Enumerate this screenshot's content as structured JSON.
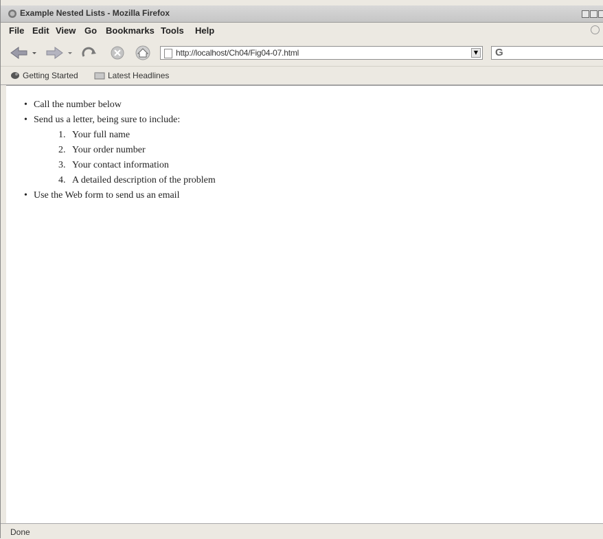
{
  "window": {
    "title": "Example Nested Lists - Mozilla Firefox"
  },
  "menu": {
    "items": [
      {
        "label": "File"
      },
      {
        "label": "Edit"
      },
      {
        "label": "View"
      },
      {
        "label": "Go"
      },
      {
        "label": "Bookmarks"
      },
      {
        "label": "Tools"
      },
      {
        "label": "Help"
      }
    ]
  },
  "navigation": {
    "url": "http://localhost/Ch04/Fig04-07.html",
    "icons": [
      "back-icon",
      "forward-icon",
      "reload-icon",
      "stop-icon",
      "home-icon"
    ]
  },
  "bookmarks": {
    "items": [
      {
        "label": "Getting Started",
        "icon": "getting-started-icon"
      },
      {
        "label": "Latest Headlines",
        "icon": "rss-folder-icon"
      }
    ]
  },
  "content": {
    "list": [
      {
        "text": "Call the number below"
      },
      {
        "text": "Send us a letter, being sure to include:"
      },
      {
        "text": "Use the Web form to send us an email"
      }
    ],
    "nested": [
      {
        "number": "1.",
        "text": "Your full name"
      },
      {
        "number": "2.",
        "text": "Your order number"
      },
      {
        "number": "3.",
        "text": "Your contact information"
      },
      {
        "number": "4.",
        "text": "A detailed description of the problem"
      }
    ]
  },
  "status": {
    "text": "Done"
  }
}
